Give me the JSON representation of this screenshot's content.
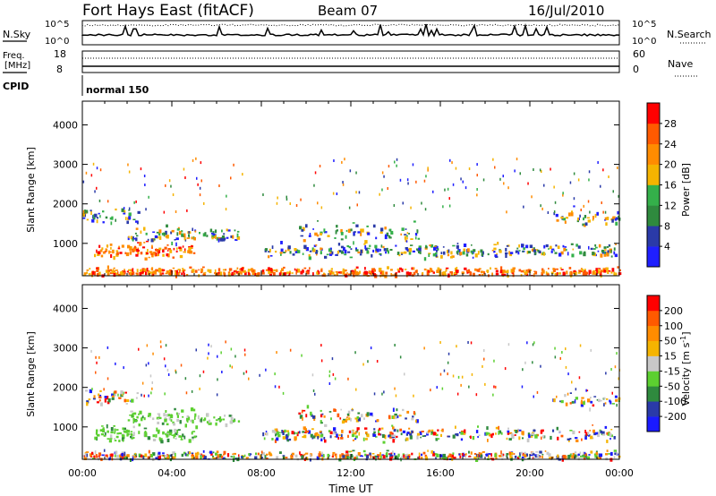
{
  "header": {
    "station": "Fort Hays East (fitACF)",
    "beam": "Beam 07",
    "date": "16/Jul/2010"
  },
  "noise_panel": {
    "left_label": "N.Sky",
    "right_label": "N.Search",
    "left_ticks": [
      "10^5",
      "10^0"
    ],
    "right_ticks": [
      "10^5",
      "10^0"
    ]
  },
  "freq_panel": {
    "left_label_top": "Freq.",
    "left_label_bottom": "[MHz]",
    "right_label": "Nave",
    "left_ticks": [
      "18",
      "8"
    ],
    "right_ticks": [
      "60",
      "0"
    ]
  },
  "cpid": {
    "label": "CPID",
    "value": "normal 150"
  },
  "chart_data": [
    {
      "type": "heatmap",
      "name": "power",
      "ylabel": "Slant Range [km]",
      "yticks": [
        "4000",
        "3000",
        "2000",
        "1000"
      ],
      "ylim": [
        180,
        4600
      ],
      "colorbar_label": "Power [dB]",
      "colorbar_ticks": [
        "28",
        "24",
        "20",
        "16",
        "12",
        "8",
        "4"
      ],
      "colors": [
        "#1f1fff",
        "#2a3aa8",
        "#2f8a3e",
        "#34b04a",
        "#f5b400",
        "#ff8c00",
        "#ff5a00",
        "#ff0000"
      ]
    },
    {
      "type": "heatmap",
      "name": "velocity",
      "ylabel": "Slant Range [km]",
      "yticks": [
        "4000",
        "3000",
        "2000",
        "1000"
      ],
      "ylim": [
        180,
        4600
      ],
      "colorbar_label": "Velocity [m s",
      "colorbar_label_sup": "-1",
      "colorbar_label_end": "]",
      "colorbar_ticks": [
        "200",
        "100",
        "50",
        "15",
        "-15",
        "-50",
        "-100",
        "-200"
      ],
      "colors": [
        "#1a1aff",
        "#2a3aa8",
        "#2f8a3e",
        "#5cd030",
        "#c8c8c8",
        "#f5b400",
        "#ff8c00",
        "#ff5a00",
        "#ff0000"
      ]
    }
  ],
  "x_axis": {
    "label": "Time UT",
    "ticks": [
      "00:00",
      "04:00",
      "08:00",
      "12:00",
      "16:00",
      "20:00",
      "00:00"
    ]
  }
}
